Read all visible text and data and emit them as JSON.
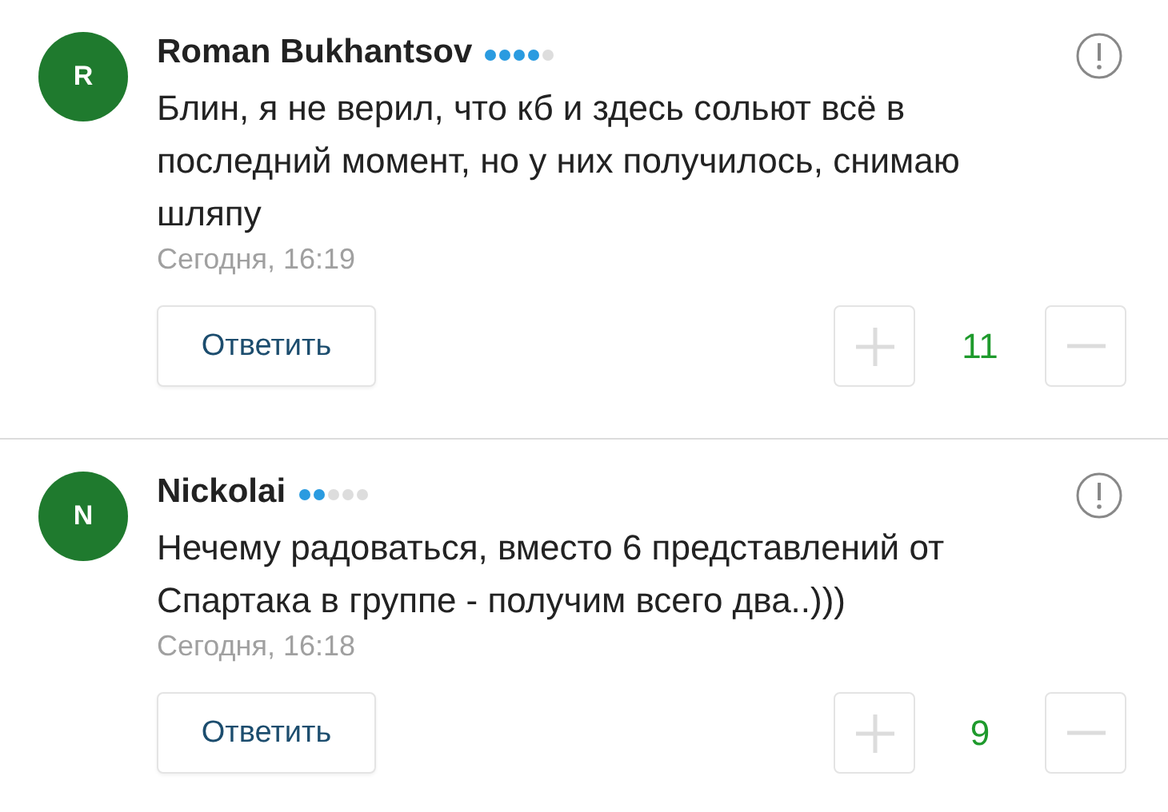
{
  "comments": [
    {
      "avatar_letter": "R",
      "author": "Roman Bukhantsov",
      "stars": 4,
      "text": "Блин, я не верил, что кб и здесь сольют всё в последний момент, но у них получилось, снимаю шляпу",
      "date": "Сегодня, 16:19",
      "reply_label": "Ответить",
      "score": "11"
    },
    {
      "avatar_letter": "N",
      "author": "Nickolai",
      "stars": 2,
      "text": "Нечему радоваться, вместо 6 представлений от Спартака в группе - получим всего два..)))",
      "date": "Сегодня, 16:18",
      "reply_label": "Ответить",
      "score": "9"
    }
  ]
}
